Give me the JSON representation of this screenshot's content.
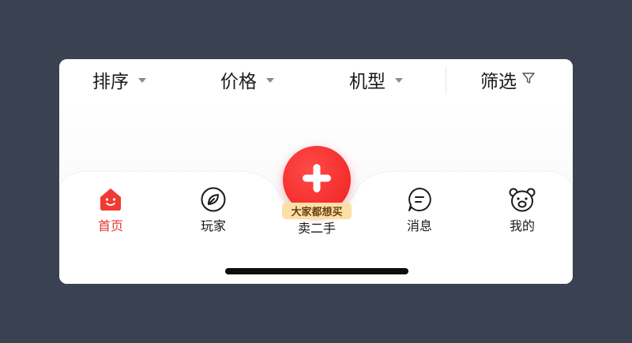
{
  "filter_bar": {
    "items": [
      {
        "label": "排序",
        "icon": "caret-down-icon"
      },
      {
        "label": "价格",
        "icon": "caret-down-icon"
      },
      {
        "label": "机型",
        "icon": "caret-down-icon"
      }
    ],
    "filter": {
      "label": "筛选",
      "icon": "funnel-icon"
    }
  },
  "tab_bar": {
    "tabs": [
      {
        "label": "首页",
        "icon": "home-icon",
        "active": true
      },
      {
        "label": "玩家",
        "icon": "compass-leaf-icon",
        "active": false
      },
      {
        "label": "消息",
        "icon": "message-icon",
        "active": false
      },
      {
        "label": "我的",
        "icon": "bear-face-icon",
        "active": false
      }
    ],
    "sell": {
      "label": "卖二手",
      "badge": "大家都想买",
      "icon": "plus-icon"
    }
  },
  "colors": {
    "accent": "#e23a31",
    "sell_button": "#f02a2a",
    "badge_bg": "#fbe0a6",
    "badge_text": "#6a3d14",
    "page_bg": "#3a4150"
  }
}
